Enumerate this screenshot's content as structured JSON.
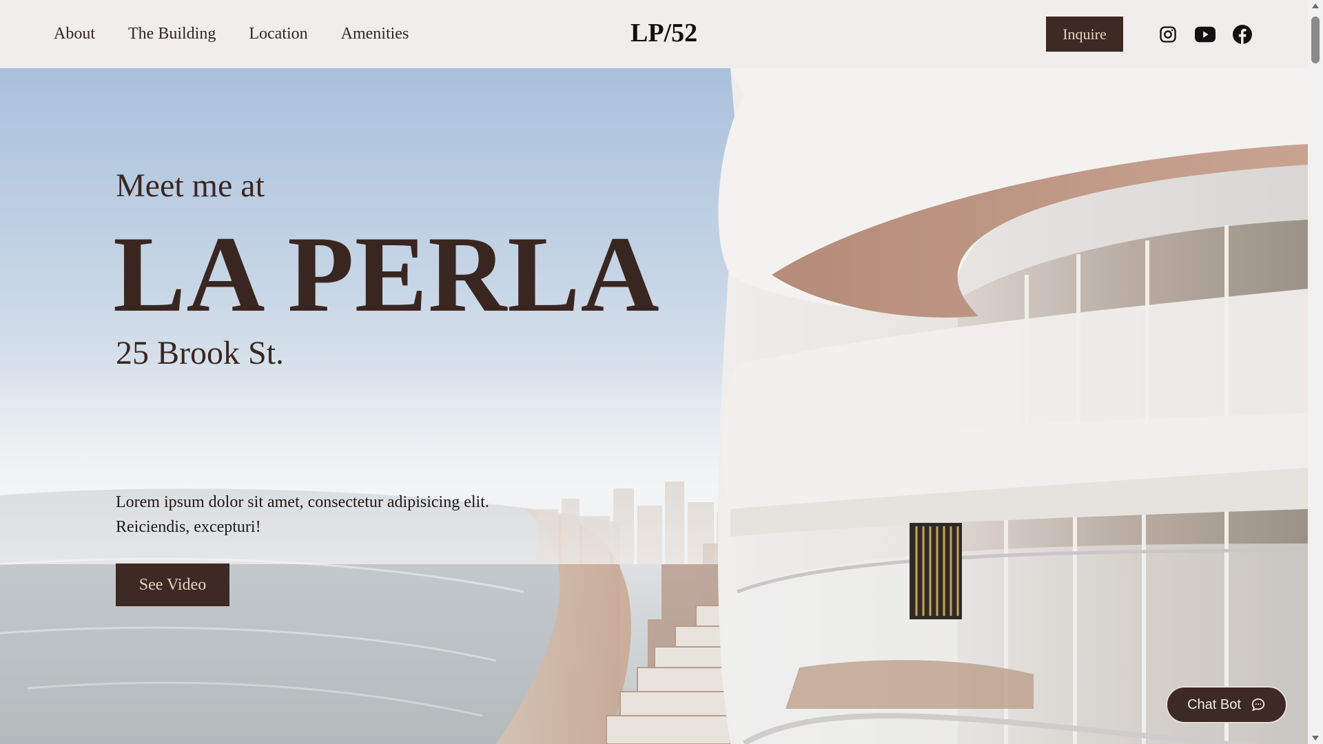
{
  "nav": {
    "links": [
      "About",
      "The Building",
      "Location",
      "Amenities"
    ],
    "brand": "LP/52",
    "inquire_label": "Inquire",
    "social_icons": [
      "instagram-icon",
      "youtube-icon",
      "facebook-icon"
    ]
  },
  "hero": {
    "eyebrow": "Meet me at",
    "title": "LA PERLA",
    "address": "25 Brook St.",
    "description": "Lorem ipsum dolor sit amet, consectetur adipisicing elit. Reiciendis, excepturi!",
    "cta_label": "See Video"
  },
  "chatbot": {
    "label": "Chat Bot",
    "icon": "chat-bubble-icon"
  },
  "colors": {
    "accent": "#3d2a25",
    "accent_text": "#e7d5bf",
    "nav_bg": "#f1edea",
    "headline": "#3a2621"
  }
}
